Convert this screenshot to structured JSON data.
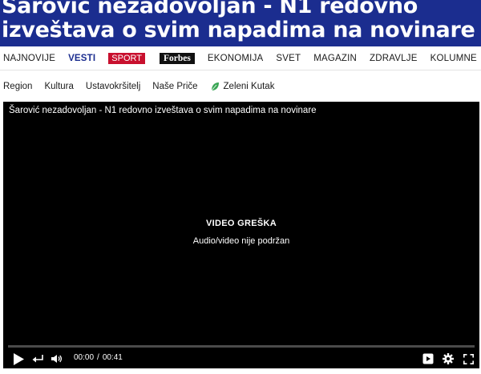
{
  "article": {
    "headline": "Šarović nezadovoljan - N1 redovno izveštava o svim napadima na novinare"
  },
  "nav_primary": {
    "items": [
      {
        "label": "NAJNOVIJE"
      },
      {
        "label": "VESTI"
      },
      {
        "label": "SPORT"
      },
      {
        "label": "Forbes"
      },
      {
        "label": "EKONOMIJA"
      },
      {
        "label": "SVET"
      },
      {
        "label": "MAGAZIN"
      },
      {
        "label": "ZDRAVLJE"
      },
      {
        "label": "KOLUMNE"
      }
    ],
    "active": "VESTI"
  },
  "nav_secondary": {
    "items": [
      {
        "label": "Region"
      },
      {
        "label": "Kultura"
      },
      {
        "label": "Ustavokršitelj"
      },
      {
        "label": "Naše Priče"
      },
      {
        "label": "Zeleni Kutak",
        "icon": "leaf-icon"
      }
    ]
  },
  "player": {
    "title": "Šarović nezadovoljan - N1 redovno izveštava o svim napadima na novinare",
    "error_title": "VIDEO GREŠKA",
    "error_message": "Audio/video nije podržan",
    "current_time": "00:00",
    "time_separator": "/",
    "duration": "00:41",
    "progress_fraction": 0
  },
  "colors": {
    "brand_blue": "#1b2d8f",
    "sport_red": "#c8102e",
    "leaf_green": "#3aa655",
    "player_bg": "#000000"
  }
}
